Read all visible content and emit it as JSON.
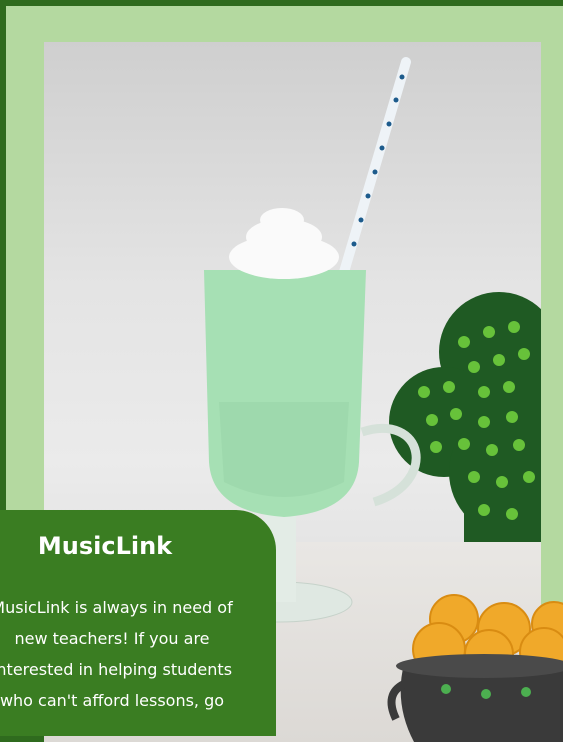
{
  "card": {
    "title": "MusicLink",
    "body": "MusicLink is always in need of\nnew teachers! If you are\ninterested in helping students\nwho can't afford lessons, go"
  },
  "colors": {
    "background": "#2f6b1e",
    "frame": "#b4d9a0",
    "card": "#3a7d22",
    "shake": "#a6e0b4",
    "shamrock": "#1f5a23",
    "shamrock_dots": "#67c23a",
    "gold": "#f0a92a"
  },
  "icons": {
    "photo": "mint-shake-photo",
    "shamrock": "shamrock-decoration",
    "pot": "pot-of-gold"
  }
}
